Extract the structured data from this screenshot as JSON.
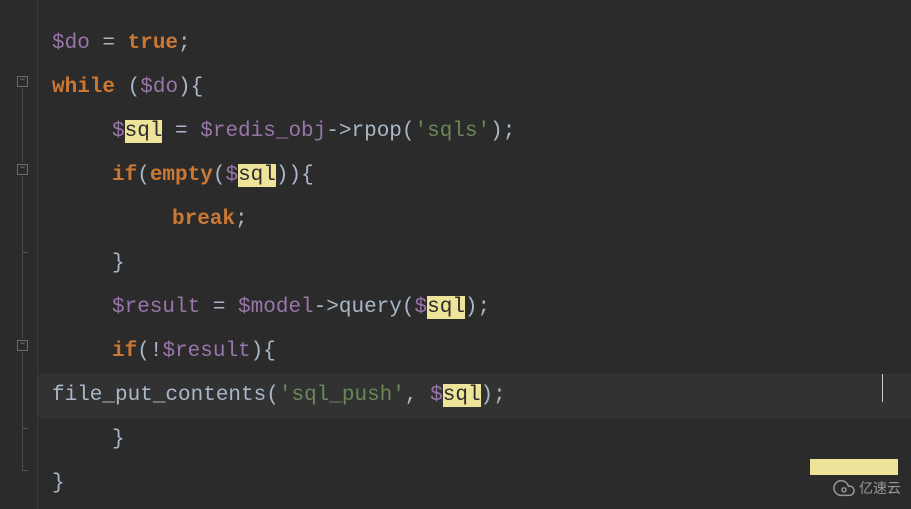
{
  "chart_data": {
    "type": "table",
    "note": "PHP code with syntax highlighting; 'sql' occurrences highlighted (search match)",
    "lines": [
      "$do = true;",
      "while ($do){",
      "    $sql = $redis_obj->rpop('sqls');",
      "    if(empty($sql)){",
      "        break;",
      "    }",
      "    $result = $model->query($sql);",
      "    if(!$result){",
      "        file_put_contents('sql_push', $sql);",
      "    }",
      "}"
    ],
    "highlighted_token": "sql",
    "current_line_index": 8
  },
  "code": {
    "l1": {
      "var_do": "$do",
      "eq": " = ",
      "true": "true",
      "semi": ";"
    },
    "l2": {
      "while": "while",
      "sp": " ",
      "op": "(",
      "var_do": "$do",
      "cp": ")",
      "ob": "{"
    },
    "l3": {
      "dollar": "$",
      "sql": "sql",
      "eq": " = ",
      "var_redis": "$redis_obj",
      "arrow": "->",
      "rpop": "rpop",
      "op": "(",
      "q1": "'",
      "sqls": "sqls",
      "q2": "'",
      "cp": ")",
      "semi": ";"
    },
    "l4": {
      "if": "if",
      "op": "(",
      "empty": "empty",
      "op2": "(",
      "dollar": "$",
      "sql": "sql",
      "cp": ")",
      "cp2": ")",
      "ob": "{"
    },
    "l5": {
      "break": "break",
      "semi": ";"
    },
    "l6": {
      "cb": "}"
    },
    "l7": {
      "var_result": "$result",
      "eq": " = ",
      "var_model": "$model",
      "arrow": "->",
      "query": "query",
      "op": "(",
      "dollar": "$",
      "sql": "sql",
      "cp": ")",
      "semi": ";"
    },
    "l8": {
      "if": "if",
      "op": "(",
      "bang": "!",
      "var_result": "$result",
      "cp": ")",
      "ob": "{"
    },
    "l9": {
      "fpc": "file_put_contents",
      "op": "(",
      "q1": "'",
      "sql_push": "sql_push",
      "q2": "'",
      "comma": ", ",
      "dollar": "$",
      "sql": "sql",
      "cp": ")",
      "semi": ";"
    },
    "l10": {
      "cb": "}"
    },
    "l11": {
      "cb": "}"
    }
  },
  "watermark": {
    "text": "亿速云"
  }
}
